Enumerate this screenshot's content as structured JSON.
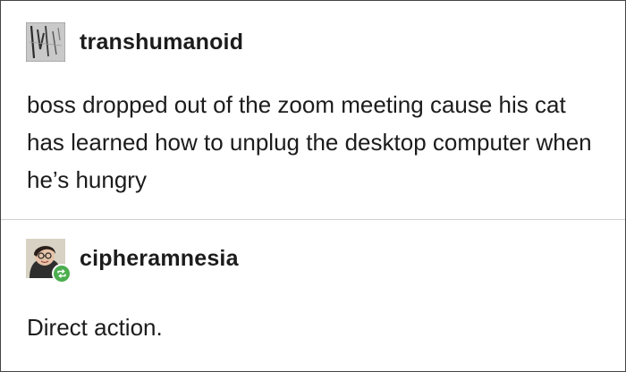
{
  "posts": [
    {
      "username": "transhumanoid",
      "avatar_icon": "sketch-avatar-icon",
      "text": "boss dropped out of the zoom meeting cause his cat has learned how to unplug the desktop computer when he’s hungry"
    },
    {
      "username": "cipheramnesia",
      "avatar_icon": "portrait-avatar-icon",
      "badge_icon": "reblog-icon",
      "badge_color": "#4cae4f",
      "text": "Direct action."
    }
  ]
}
